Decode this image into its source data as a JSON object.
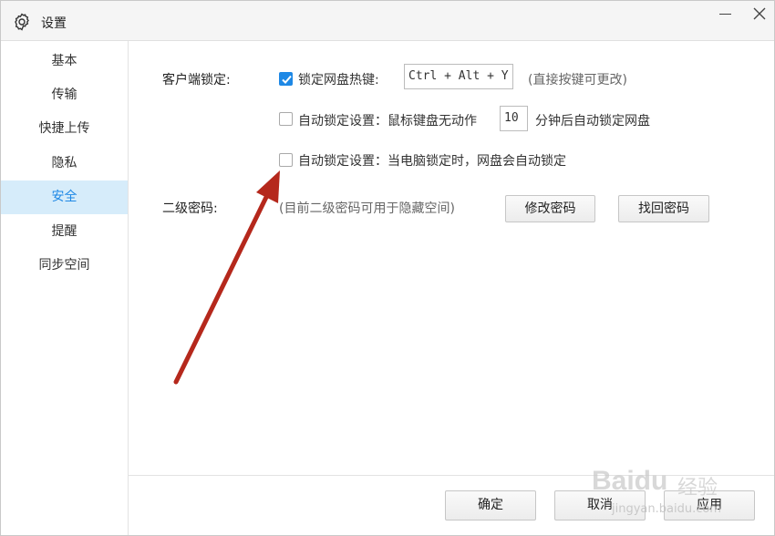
{
  "window": {
    "title": "设置"
  },
  "sidebar": {
    "items": [
      {
        "label": "基本"
      },
      {
        "label": "传输"
      },
      {
        "label": "快捷上传"
      },
      {
        "label": "隐私"
      },
      {
        "label": "安全",
        "active": true
      },
      {
        "label": "提醒"
      },
      {
        "label": "同步空间"
      }
    ]
  },
  "client_lock": {
    "section_label": "客户端锁定:",
    "hotkey": {
      "checked": true,
      "label": "锁定网盘热键:",
      "value": "Ctrl + Alt + Y",
      "hint": "(直接按键可更改)"
    },
    "idle_lock": {
      "checked": false,
      "prefix": "自动锁定设置：鼠标键盘无动作",
      "minutes": "10",
      "suffix": "分钟后自动锁定网盘"
    },
    "pc_lock": {
      "checked": false,
      "label": "自动锁定设置：当电脑锁定时，网盘会自动锁定"
    }
  },
  "secondary_password": {
    "section_label": "二级密码:",
    "note": "(目前二级密码可用于隐藏空间)",
    "change_button": "修改密码",
    "recover_button": "找回密码"
  },
  "footer": {
    "ok": "确定",
    "cancel": "取消",
    "apply": "应用"
  },
  "watermark": {
    "brand": "Baidu",
    "sub": "经验",
    "url": "jingyan.baidu.com"
  },
  "colors": {
    "accent": "#1e88e5",
    "active_bg": "#d6ecfa",
    "annotation_arrow": "#b5281c"
  }
}
